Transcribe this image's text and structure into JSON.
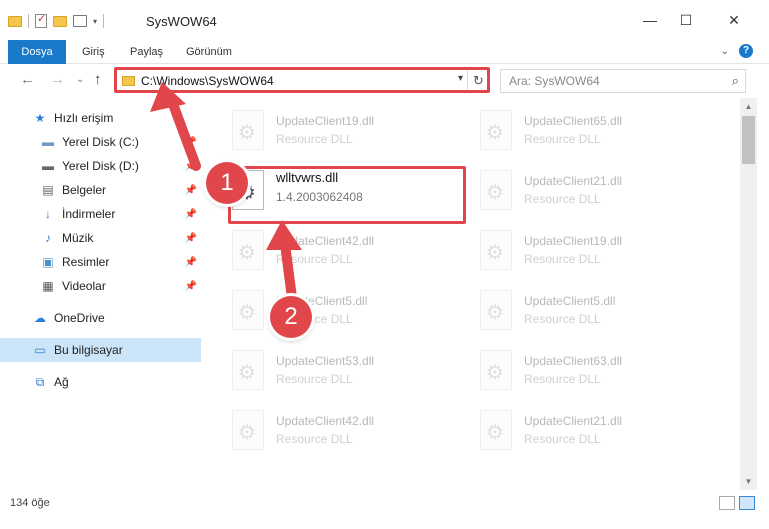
{
  "window": {
    "title": "SysWOW64",
    "minimize": "—",
    "maximize": "☐",
    "close": "✕"
  },
  "ribbon": {
    "tabs": [
      "Dosya",
      "Giriş",
      "Paylaş",
      "Görünüm"
    ],
    "help": "?"
  },
  "nav": {
    "back": "←",
    "forward": "→",
    "recent": "⌄",
    "up": "↑"
  },
  "address": {
    "path": "C:\\Windows\\SysWOW64",
    "refresh": "↻"
  },
  "search": {
    "placeholder": "Ara: SysWOW64"
  },
  "sidebar": {
    "items": [
      {
        "label": "Hızlı erişim",
        "icon": "star-icon",
        "pinned": false
      },
      {
        "label": "Yerel Disk (C:)",
        "icon": "drive-icon",
        "pinned": true
      },
      {
        "label": "Yerel Disk (D:)",
        "icon": "drive-icon",
        "pinned": true
      },
      {
        "label": "Belgeler",
        "icon": "documents-icon",
        "pinned": true
      },
      {
        "label": "İndirmeler",
        "icon": "download-icon",
        "pinned": true
      },
      {
        "label": "Müzik",
        "icon": "music-icon",
        "pinned": true
      },
      {
        "label": "Resimler",
        "icon": "pictures-icon",
        "pinned": true
      },
      {
        "label": "Videolar",
        "icon": "video-icon",
        "pinned": true
      },
      {
        "label": "OneDrive",
        "icon": "cloud-icon",
        "pinned": false
      },
      {
        "label": "Bu bilgisayar",
        "icon": "computer-icon",
        "pinned": false
      },
      {
        "label": "Ağ",
        "icon": "network-icon",
        "pinned": false
      }
    ],
    "selected": "Bu bilgisayar"
  },
  "files": [
    {
      "name": "UpdateClient19.dll",
      "desc": "Resource DLL"
    },
    {
      "name": "UpdateClient65.dll",
      "desc": "Resource DLL"
    },
    {
      "name": "wlltvwrs.dll",
      "desc": "1.4.2003062408"
    },
    {
      "name": "UpdateClient21.dll",
      "desc": "Resource DLL"
    },
    {
      "name": "UpdateClient42.dll",
      "desc": "Resource DLL"
    },
    {
      "name": "UpdateClient19.dll",
      "desc": "Resource DLL"
    },
    {
      "name": "UpdateClient5.dll",
      "desc": "Resource DLL"
    },
    {
      "name": "UpdateClient5.dll",
      "desc": "Resource DLL"
    },
    {
      "name": "UpdateClient53.dll",
      "desc": "Resource DLL"
    },
    {
      "name": "UpdateClient63.dll",
      "desc": "Resource DLL"
    },
    {
      "name": "UpdateClient42.dll",
      "desc": "Resource DLL"
    },
    {
      "name": "UpdateClient21.dll",
      "desc": "Resource DLL"
    }
  ],
  "status": {
    "count": "134 öğe"
  },
  "callouts": [
    "1",
    "2"
  ],
  "colors": {
    "accent": "#1979ca",
    "highlight": "#e0464a",
    "selected": "#cce4f7"
  }
}
